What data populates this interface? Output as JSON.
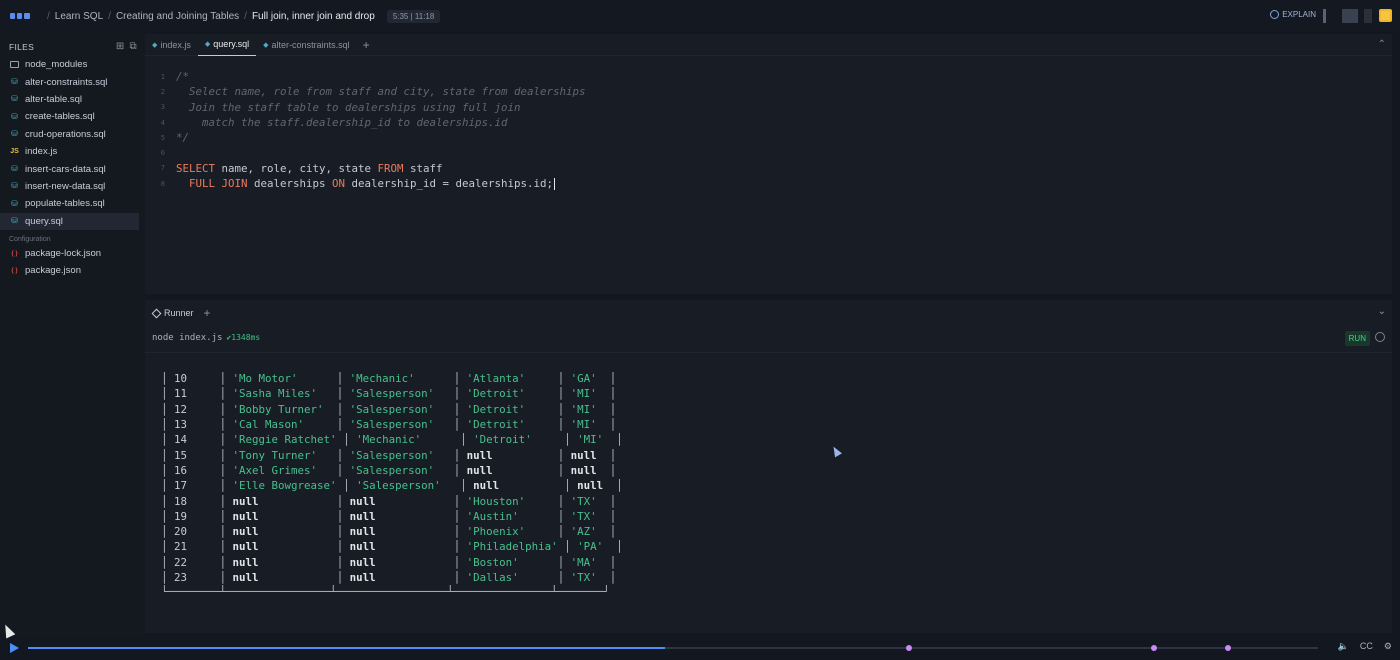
{
  "breadcrumb": {
    "items": [
      "Learn SQL",
      "Creating and Joining Tables",
      "Full join, inner join and drop"
    ],
    "time": "5:35 | 11:18"
  },
  "topbar": {
    "explain_label": "EXPLAIN"
  },
  "sidebar": {
    "title": "FILES",
    "files": [
      {
        "name": "node_modules",
        "icon": "folder-icon"
      },
      {
        "name": "alter-constraints.sql",
        "icon": "database-icon"
      },
      {
        "name": "alter-table.sql",
        "icon": "database-icon"
      },
      {
        "name": "create-tables.sql",
        "icon": "database-icon"
      },
      {
        "name": "crud-operations.sql",
        "icon": "database-icon"
      },
      {
        "name": "index.js",
        "icon": "js-icon"
      },
      {
        "name": "insert-cars-data.sql",
        "icon": "database-icon"
      },
      {
        "name": "insert-new-data.sql",
        "icon": "database-icon"
      },
      {
        "name": "populate-tables.sql",
        "icon": "database-icon"
      },
      {
        "name": "query.sql",
        "icon": "database-icon",
        "active": true
      }
    ],
    "config_label": "Configuration",
    "config_files": [
      {
        "name": "package-lock.json",
        "icon": "json-icon"
      },
      {
        "name": "package.json",
        "icon": "json-icon"
      }
    ]
  },
  "editor": {
    "tabs": [
      {
        "label": "index.js"
      },
      {
        "label": "query.sql",
        "active": true
      },
      {
        "label": "alter-constraints.sql"
      }
    ],
    "lines": [
      {
        "n": "1",
        "comment": "/*"
      },
      {
        "n": "2",
        "comment": "  Select name, role from staff and city, state from dealerships"
      },
      {
        "n": "3",
        "comment": "  Join the staff table to dealerships using full join"
      },
      {
        "n": "4",
        "comment": "    match the staff.dealership_id to dealerships.id"
      },
      {
        "n": "5",
        "comment": "*/"
      },
      {
        "n": "6",
        "comment": ""
      },
      {
        "n": "7",
        "kw1": "SELECT",
        "t1": " name, role, city, state ",
        "kw2": "FROM",
        "t2": " staff"
      },
      {
        "n": "8",
        "kw1": "  FULL JOIN",
        "t1": " dealerships ",
        "kw2": "ON",
        "t2": " dealership_id = dealerships.id;"
      }
    ]
  },
  "runner": {
    "tab_label": "Runner",
    "command": "node index.js",
    "duration": "✔1348ms",
    "run_label": "RUN",
    "rows": [
      {
        "i": "10",
        "name": "'Mo Motor'",
        "role": "'Mechanic'",
        "city": "'Atlanta'",
        "state": "'GA'"
      },
      {
        "i": "11",
        "name": "'Sasha Miles'",
        "role": "'Salesperson'",
        "city": "'Detroit'",
        "state": "'MI'"
      },
      {
        "i": "12",
        "name": "'Bobby Turner'",
        "role": "'Salesperson'",
        "city": "'Detroit'",
        "state": "'MI'"
      },
      {
        "i": "13",
        "name": "'Cal Mason'",
        "role": "'Salesperson'",
        "city": "'Detroit'",
        "state": "'MI'"
      },
      {
        "i": "14",
        "name": "'Reggie Ratchet'",
        "role": "'Mechanic'",
        "city": "'Detroit'",
        "state": "'MI'"
      },
      {
        "i": "15",
        "name": "'Tony Turner'",
        "role": "'Salesperson'",
        "city": "null",
        "state": "null"
      },
      {
        "i": "16",
        "name": "'Axel Grimes'",
        "role": "'Salesperson'",
        "city": "null",
        "state": "null"
      },
      {
        "i": "17",
        "name": "'Elle Bowgrease'",
        "role": "'Salesperson'",
        "city": "null",
        "state": "null"
      },
      {
        "i": "18",
        "name": "null",
        "role": "null",
        "city": "'Houston'",
        "state": "'TX'"
      },
      {
        "i": "19",
        "name": "null",
        "role": "null",
        "city": "'Austin'",
        "state": "'TX'"
      },
      {
        "i": "20",
        "name": "null",
        "role": "null",
        "city": "'Phoenix'",
        "state": "'AZ'"
      },
      {
        "i": "21",
        "name": "null",
        "role": "null",
        "city": "'Philadelphia'",
        "state": "'PA'"
      },
      {
        "i": "22",
        "name": "null",
        "role": "null",
        "city": "'Boston'",
        "state": "'MA'"
      },
      {
        "i": "23",
        "name": "null",
        "role": "null",
        "city": "'Dallas'",
        "state": "'TX'"
      }
    ]
  },
  "playback": {
    "progress_fraction": 0.494,
    "marker_fractions": [
      0.683,
      0.873,
      0.93
    ],
    "cc_label": "CC"
  }
}
